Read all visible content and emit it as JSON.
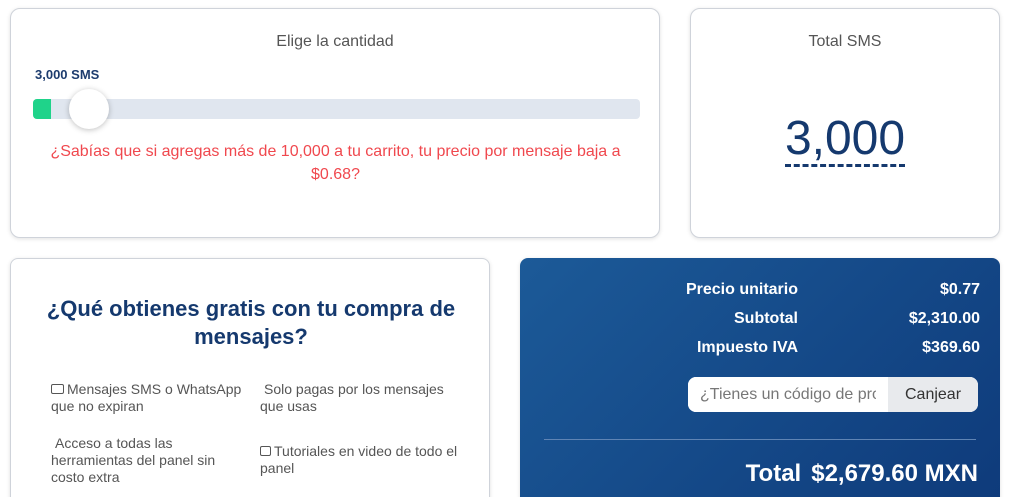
{
  "quantity": {
    "title": "Elige la cantidad",
    "selected_label": "3,000 SMS",
    "slider_fraction": 0.06,
    "promo": "¿Sabías que si agregas más de 10,000 a tu carrito, tu precio por mensaje baja a $0.68?"
  },
  "total_sms": {
    "title": "Total SMS",
    "value": "3,000"
  },
  "benefits": {
    "title": "¿Qué obtienes gratis con tu compra de mensajes?",
    "items": [
      {
        "icon": "envelope-icon",
        "text": "Mensajes SMS o WhatsApp que no expiran"
      },
      {
        "icon": "",
        "text": "Solo pagas por los mensajes que usas"
      },
      {
        "icon": "",
        "text": "Acceso a todas las herramientas del panel sin costo extra"
      },
      {
        "icon": "video-icon",
        "text": "Tutoriales en video de todo el panel"
      }
    ]
  },
  "summary": {
    "unit_price_label": "Precio unitario",
    "unit_price": "$0.77",
    "subtotal_label": "Subtotal",
    "subtotal": "$2,310.00",
    "tax_label": "Impuesto IVA",
    "tax": "$369.60",
    "coupon_placeholder": "¿Tienes un código de promoción?",
    "coupon_button": "Canjear",
    "total_label": "Total",
    "total": "$2,679.60 MXN"
  },
  "colors": {
    "accent_green": "#1fd38a",
    "promo_red": "#f0484e",
    "brand_navy": "#15396e"
  }
}
